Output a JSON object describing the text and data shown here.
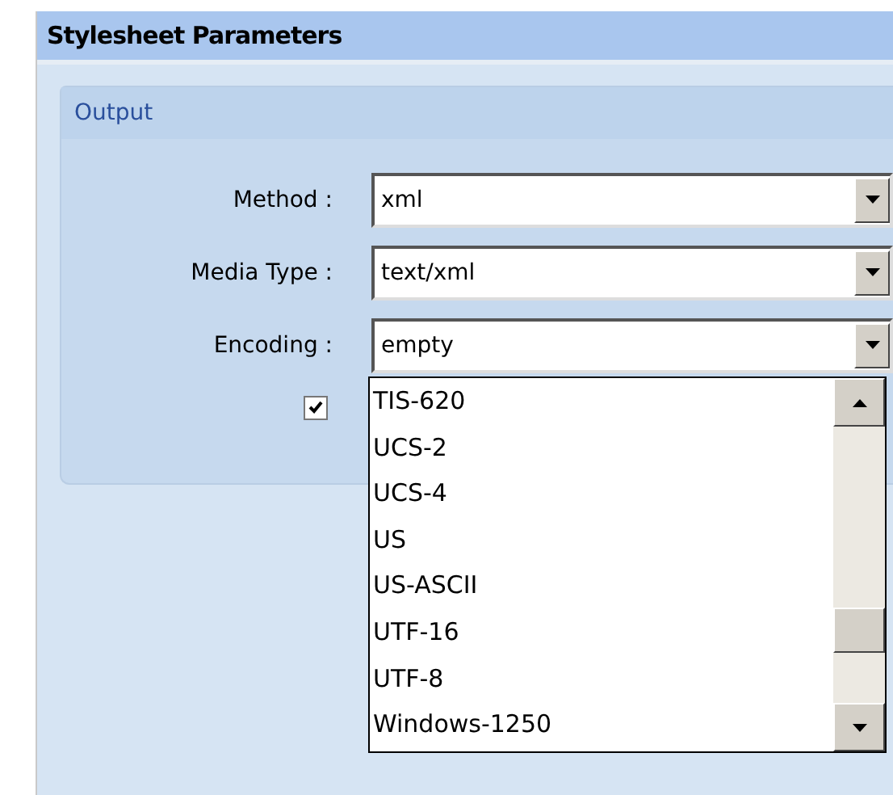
{
  "panel": {
    "title": "Stylesheet Parameters"
  },
  "group": {
    "title": "Output"
  },
  "fields": [
    {
      "label": "Method :",
      "value": "xml"
    },
    {
      "label": "Media Type :",
      "value": "text/xml"
    },
    {
      "label": "Encoding :",
      "value": "empty"
    }
  ],
  "checkbox": {
    "checked": true
  },
  "dropdown": {
    "items": [
      {
        "label": "TIS-620",
        "selected": false
      },
      {
        "label": "UCS-2",
        "selected": false
      },
      {
        "label": "UCS-4",
        "selected": false
      },
      {
        "label": "US",
        "selected": false
      },
      {
        "label": "US-ASCII",
        "selected": false
      },
      {
        "label": "UTF-16",
        "selected": false
      },
      {
        "label": "UTF-8",
        "selected": false
      },
      {
        "label": "Windows-1250",
        "selected": false
      }
    ]
  }
}
